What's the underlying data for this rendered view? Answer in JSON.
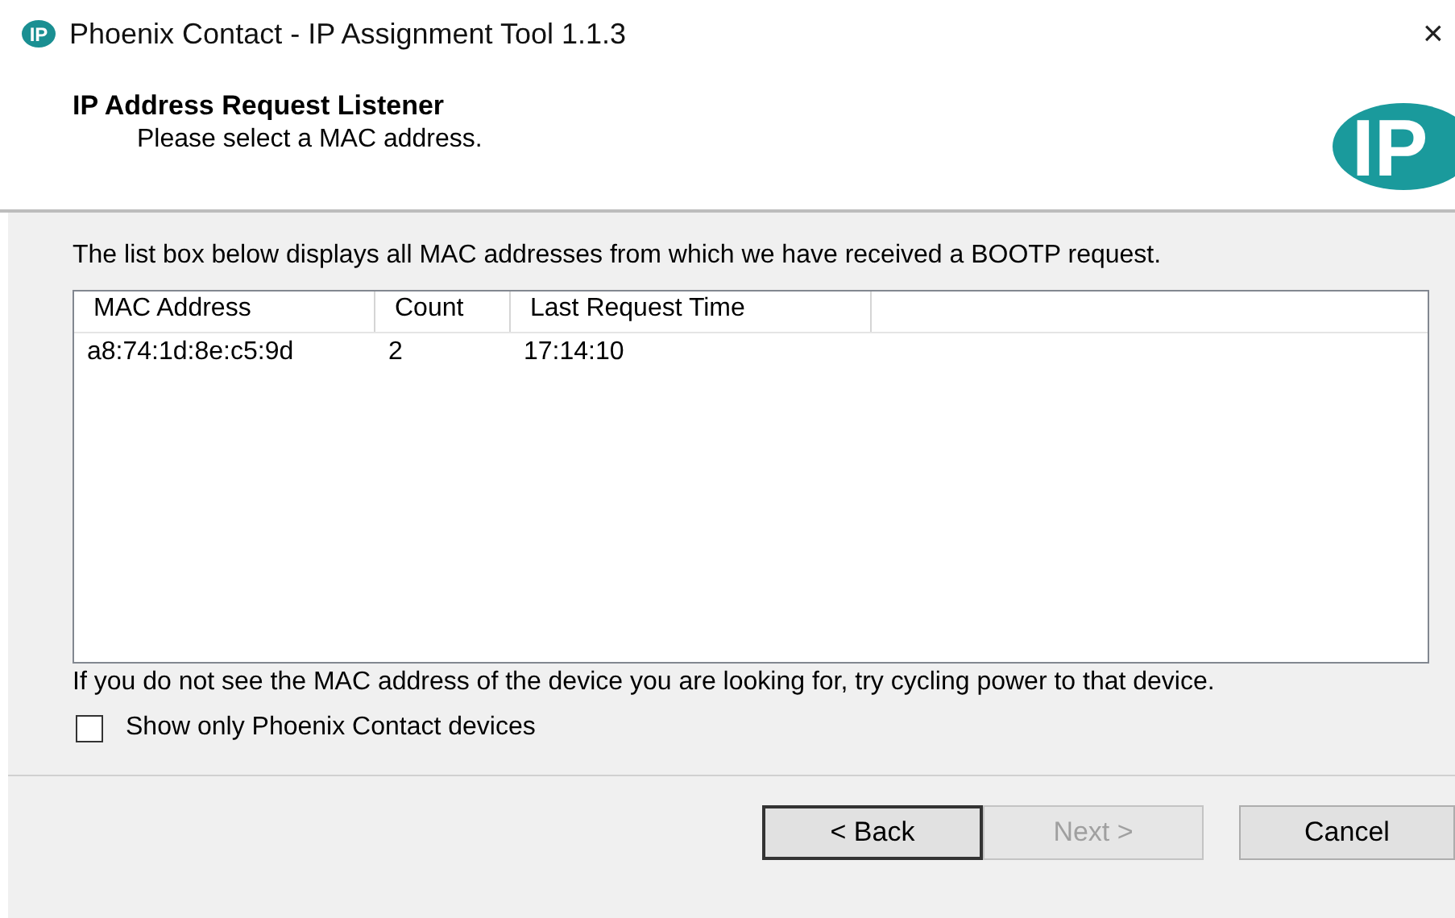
{
  "window": {
    "title": "Phoenix Contact - IP Assignment Tool 1.1.3",
    "icon_text": "IP",
    "close": "×"
  },
  "header": {
    "title": "IP Address Request Listener",
    "subtitle": "Please select a MAC address.",
    "logo_text": "IP"
  },
  "intro": "The list box below displays all MAC addresses from which we have received a BOOTP request.",
  "table": {
    "columns": [
      "MAC Address",
      "Count",
      "Last Request Time"
    ],
    "rows": [
      {
        "cells": [
          "a8:74:1d:8e:c5:9d",
          "2",
          "17:14:10"
        ],
        "selected": false
      }
    ]
  },
  "hint": "If you do not see the MAC address of the device you are looking for, try cycling power to that device.",
  "checkbox": {
    "label": "Show only Phoenix Contact devices",
    "checked": false
  },
  "buttons": [
    {
      "label": "< Back",
      "disabled": false
    },
    {
      "label": "Next >",
      "disabled": true
    },
    {
      "label": "Cancel",
      "disabled": false
    }
  ]
}
